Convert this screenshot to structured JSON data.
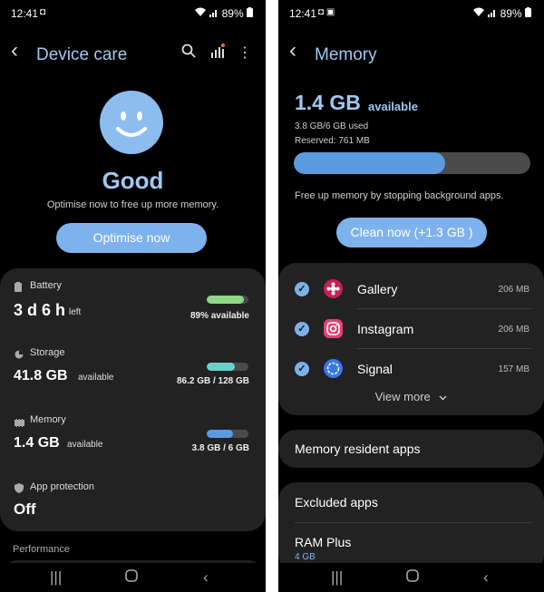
{
  "status": {
    "time": "12:41",
    "battery_pct": "89%",
    "left_icons": "◘",
    "right_icons": "◘ ▣"
  },
  "left": {
    "title": "Device care",
    "status_label": "Good",
    "subtitle": "Optimise now to free up more memory.",
    "optimise_button": "Optimise now",
    "battery": {
      "label": "Battery",
      "value": "3 d 6 h",
      "suffix": "left",
      "detail": "89% available",
      "fill": 0.89,
      "color": "#8fd886"
    },
    "storage": {
      "label": "Storage",
      "value": "41.8 GB",
      "suffix": "available",
      "detail": "86.2 GB / 128 GB",
      "fill": 0.67,
      "color": "#6bd0cc"
    },
    "memory": {
      "label": "Memory",
      "value": "1.4 GB",
      "suffix": "available",
      "detail": "3.8 GB / 6 GB",
      "fill": 0.63,
      "color": "#5a9be0"
    },
    "app_protection": {
      "label": "App protection",
      "value": "Off"
    },
    "performance_label": "Performance"
  },
  "right": {
    "title": "Memory",
    "available_value": "1.4 GB",
    "available_suffix": "available",
    "used_text": "3.8 GB/6 GB used",
    "reserved_text": "Reserved: 761 MB",
    "usage_fill": 0.64,
    "free_up_text": "Free up memory by stopping background apps.",
    "clean_button": "Clean now (+1.3 GB )",
    "apps": [
      {
        "name": "Gallery",
        "size": "206 MB",
        "color": "#c81e5a"
      },
      {
        "name": "Instagram",
        "size": "206 MB",
        "color": "#e4407a"
      },
      {
        "name": "Signal",
        "size": "157 MB",
        "color": "#3a76f0"
      }
    ],
    "view_more": "View more",
    "memory_resident_apps": "Memory resident apps",
    "excluded_apps": "Excluded apps",
    "ram_plus_label": "RAM Plus",
    "ram_plus_value": "4 GB"
  }
}
